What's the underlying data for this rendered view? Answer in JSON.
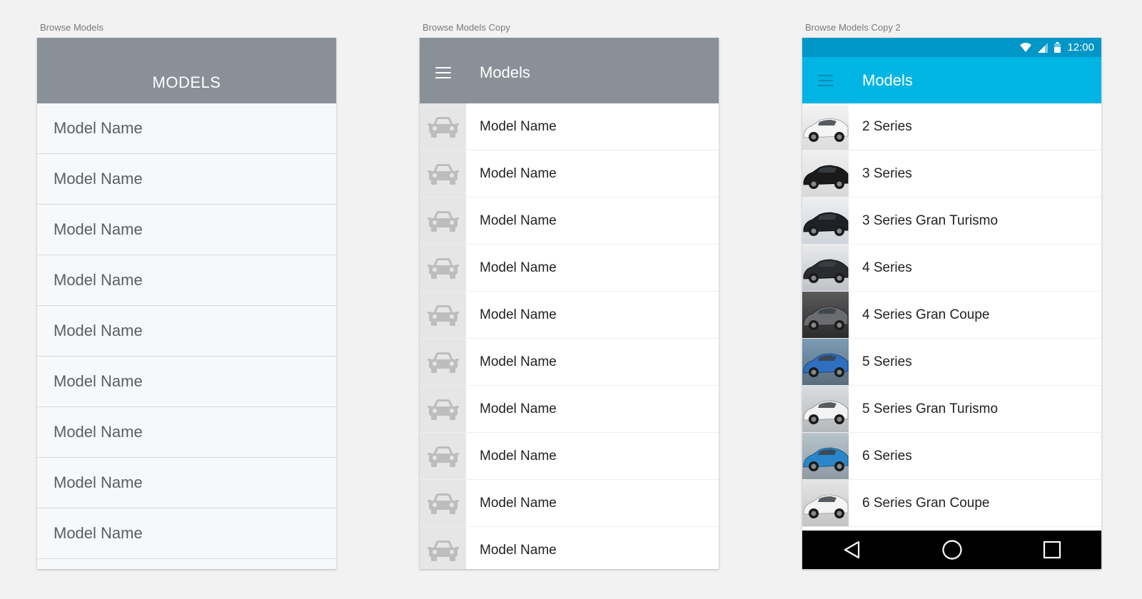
{
  "artboards": [
    {
      "label": "Browse Models"
    },
    {
      "label": "Browse Models Copy"
    },
    {
      "label": "Browse Models Copy 2"
    }
  ],
  "screen1": {
    "title": "MODELS",
    "items": [
      "Model Name",
      "Model Name",
      "Model Name",
      "Model Name",
      "Model Name",
      "Model Name",
      "Model Name",
      "Model Name",
      "Model Name"
    ]
  },
  "screen2": {
    "title": "Models",
    "icons": {
      "menu": "menu-icon",
      "item": "car-icon"
    },
    "items": [
      "Model Name",
      "Model Name",
      "Model Name",
      "Model Name",
      "Model Name",
      "Model Name",
      "Model Name",
      "Model Name",
      "Model Name",
      "Model Name"
    ]
  },
  "screen3": {
    "status": {
      "time": "12:00"
    },
    "title": "Models",
    "colors": {
      "statusbar": "#0096c7",
      "appbar": "#00b4e4"
    },
    "items": [
      "2 Series",
      "3 Series",
      "3 Series Gran Turismo",
      "4 Series",
      "4 Series Gran Coupe",
      "5 Series",
      "5 Series Gran Turismo",
      "6 Series",
      "6 Series Gran Coupe"
    ],
    "nav": {
      "back": "back-icon",
      "home": "home-icon",
      "recents": "recents-icon"
    }
  }
}
